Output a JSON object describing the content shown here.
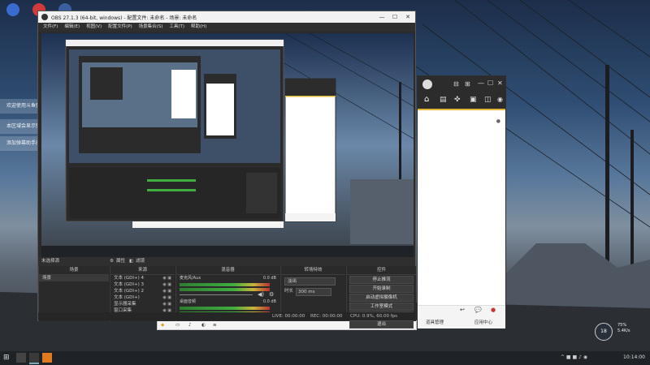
{
  "obs": {
    "title": "OBS 27.1.3 (64-bit, windows) - 配置文件: 未命名 - 场景: 未命名",
    "menu": [
      "文件(F)",
      "编辑(E)",
      "视图(V)",
      "配置文件(P)",
      "场景集合(S)",
      "工具(T)",
      "帮助(H)"
    ],
    "window_controls": [
      "—",
      "☐",
      "✕"
    ]
  },
  "notifications": [
    "欢迎使用斗鱼弹幕助手",
    "本区域会显示弹幕消息和礼物消息",
    "添加弹幕助手成功"
  ],
  "docks": {
    "scenes_header": "场景",
    "sources_header": "来源",
    "mixer_header": "混音器",
    "transitions_header": "转场特效",
    "controls_header": "控件",
    "unselected_label": "未选择源",
    "properties_label": "属性",
    "filters_label": "滤镜",
    "scenes": [
      "场景"
    ],
    "sources": [
      {
        "name": "文本 (GDI+) 4"
      },
      {
        "name": "文本 (GDI+) 3"
      },
      {
        "name": "文本 (GDI+) 2"
      },
      {
        "name": "文本 (GDI+)"
      },
      {
        "name": "显示器采集"
      },
      {
        "name": "窗口采集"
      }
    ],
    "mixer": [
      {
        "name": "麦克风/Aux",
        "db": "0.0 dB"
      },
      {
        "name": "桌面音频",
        "db": "0.0 dB"
      }
    ],
    "transition": {
      "type": "淡出",
      "duration_label": "时长",
      "duration": "300 ms"
    },
    "controls": [
      "停止推流",
      "开始录制",
      "启动虚拟摄像机",
      "工作室模式",
      "设置",
      "退出"
    ]
  },
  "status_bar": {
    "live": "LIVE: 00:00:00",
    "rec": "REC: 00:00:00",
    "cpu": "CPU: 0.9%, 60.00 fps",
    "frame": "LIVE:",
    "kb": "kb/s"
  },
  "nested": {
    "title_small": "OBS 27.1.3 (64-bit, windows) - 配置文件: 未命名 - 场景: 未命名",
    "room_label": "房间管理",
    "tools_label": "弹幕",
    "bottom_right": "应用中心"
  },
  "right_window": {
    "bottom_left": "道具管理",
    "bottom_right": "应用中心"
  },
  "tray": {
    "temperature": "18",
    "clock_time": "10:14:00",
    "percent1": "75%",
    "speed": "5.4K/s"
  },
  "colors": {
    "accent_yellow": "#e0b93b",
    "obs_bg": "#2b2b2b",
    "meter_green": "#3fae3f"
  }
}
